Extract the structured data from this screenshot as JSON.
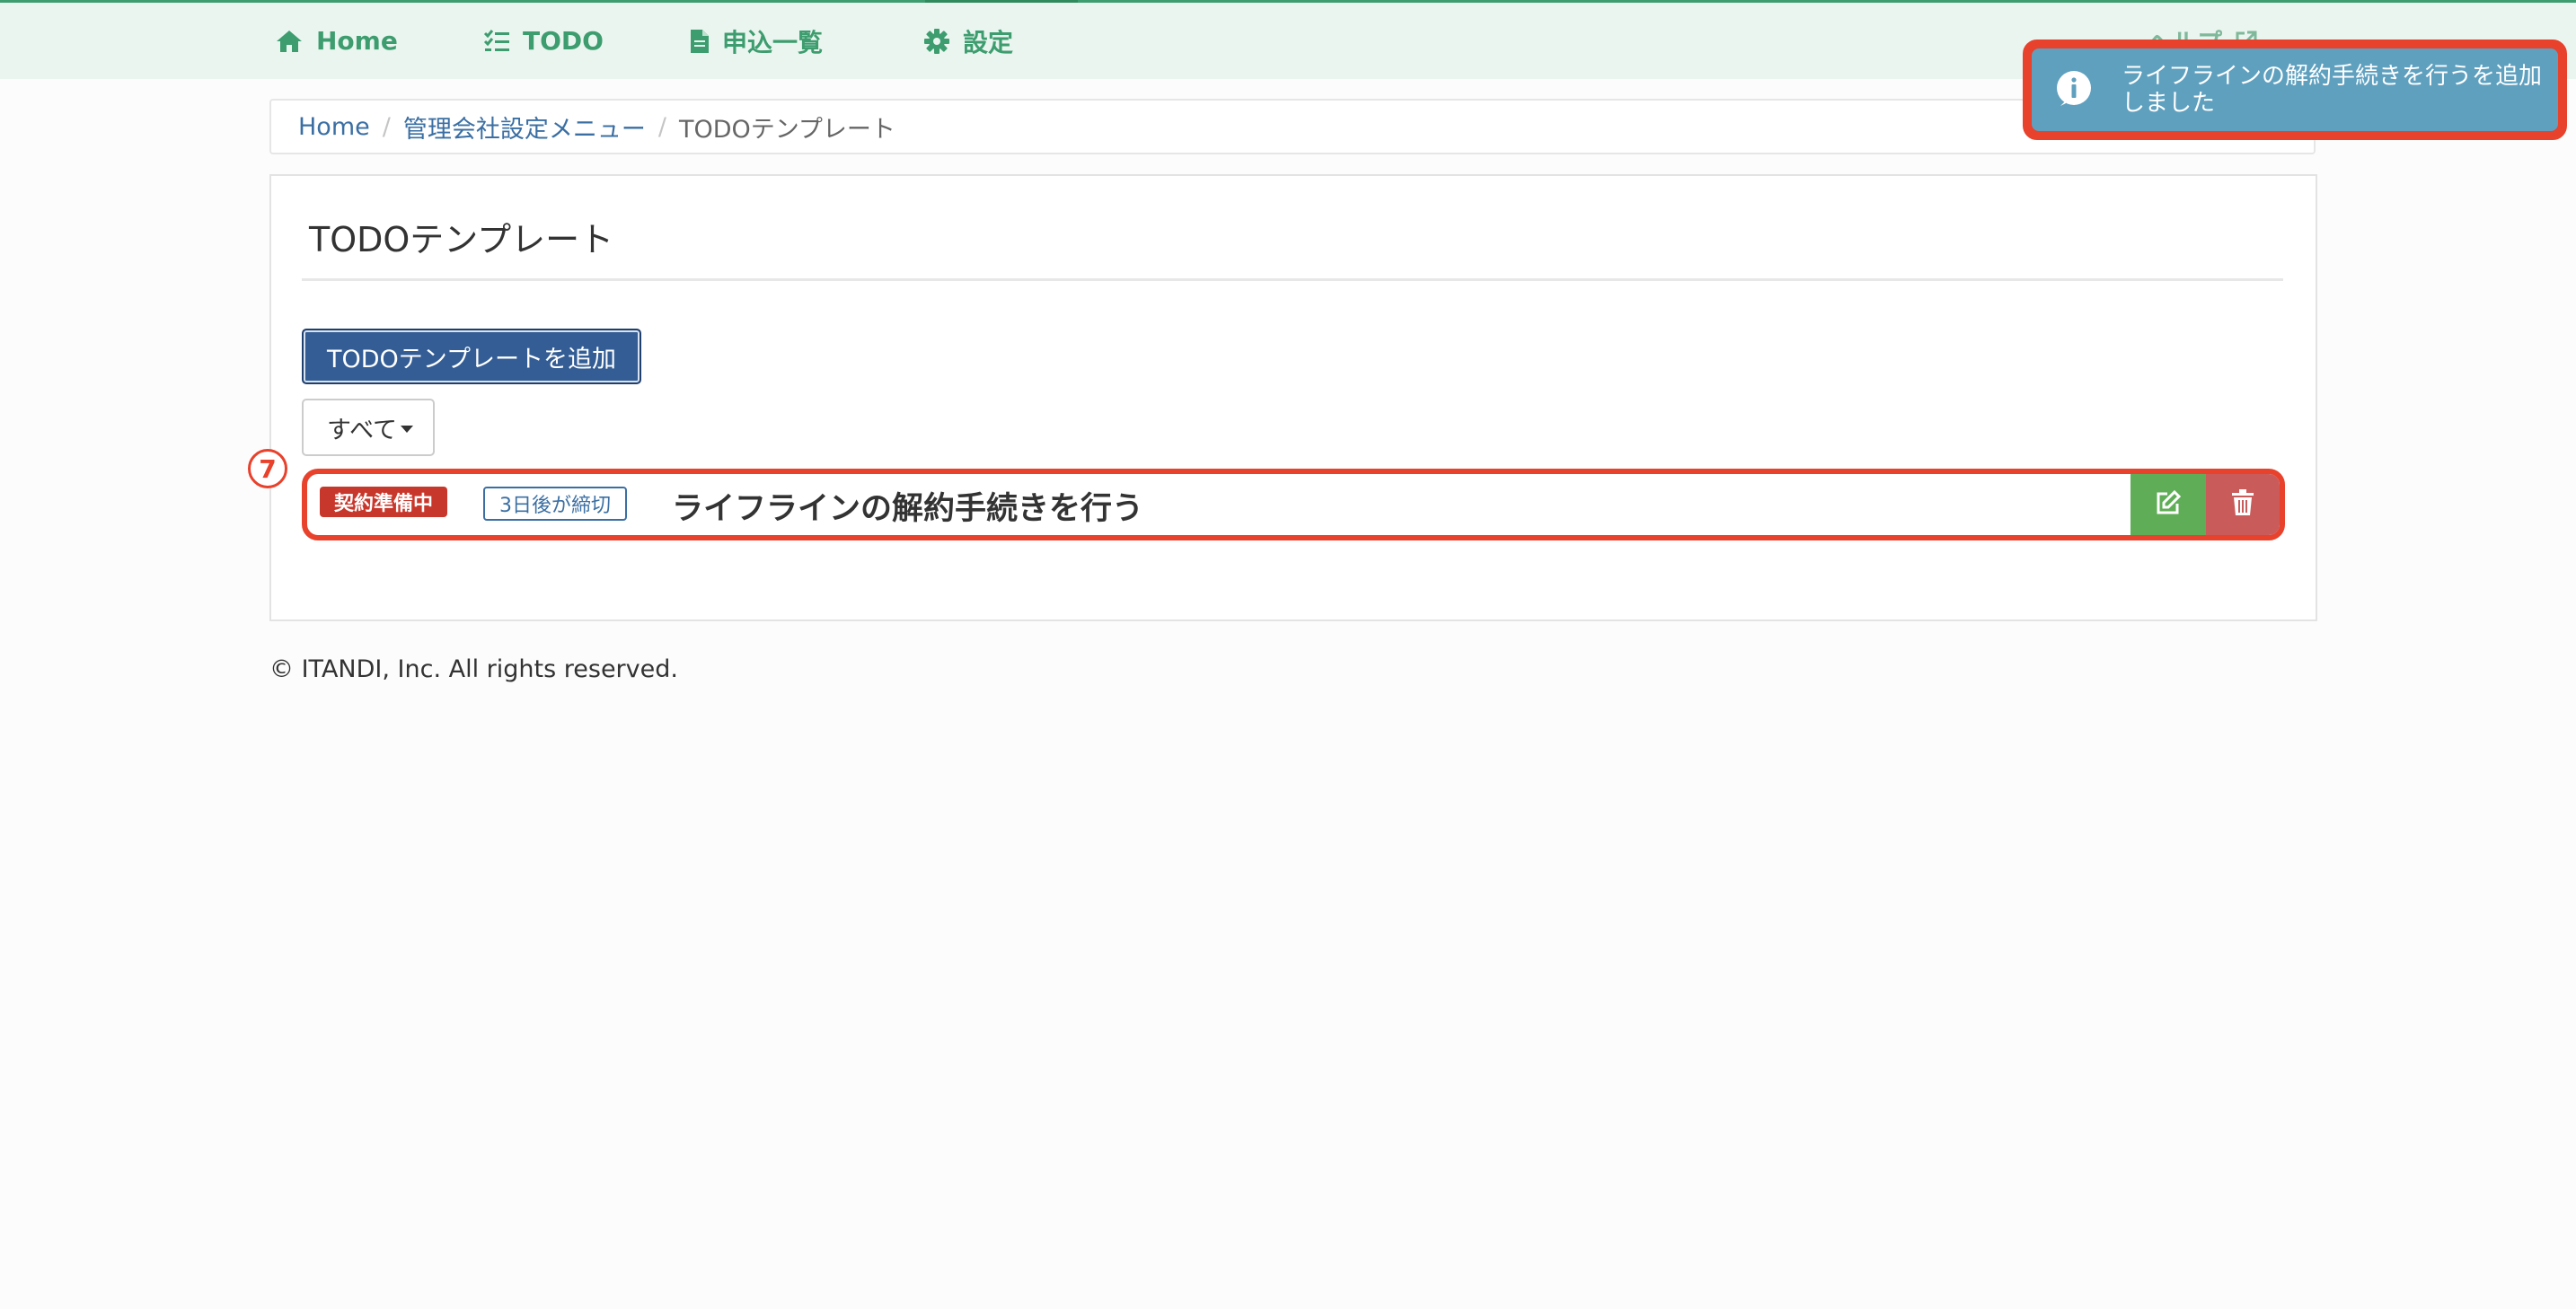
{
  "nav": {
    "items": [
      {
        "label": "Home",
        "icon": "home-icon"
      },
      {
        "label": "TODO",
        "icon": "checklist-icon"
      },
      {
        "label": "申込一覧",
        "icon": "document-icon"
      },
      {
        "label": "設定",
        "icon": "gear-icon"
      }
    ],
    "help_label": "ヘルプ",
    "help_icon": "external-link-icon"
  },
  "breadcrumb": {
    "items": [
      "Home",
      "管理会社設定メニュー"
    ],
    "current": "TODOテンプレート"
  },
  "page": {
    "title": "TODOテンプレート",
    "add_button_label": "TODOテンプレートを追加",
    "filter_label": "すべて"
  },
  "todo_items": [
    {
      "status": "契約準備中",
      "deadline": "3日後が締切",
      "title": "ライフラインの解約手続きを行う",
      "edit_icon": "edit-icon",
      "delete_icon": "trash-icon"
    }
  ],
  "annotation": {
    "step_marker": "7"
  },
  "footer": {
    "copyright": "© ITANDI, Inc. All rights reserved."
  },
  "toast": {
    "icon": "info-icon",
    "message": "ライフラインの解約手続きを行うを追加しました"
  },
  "colors": {
    "nav_accent": "#3d9d6f",
    "primary_button": "#335d94",
    "status_badge": "#c8372c",
    "edit_button": "#5fad56",
    "delete_button": "#c95b5b",
    "toast_bg": "#5fa0bf",
    "highlight": "#e8412c"
  }
}
